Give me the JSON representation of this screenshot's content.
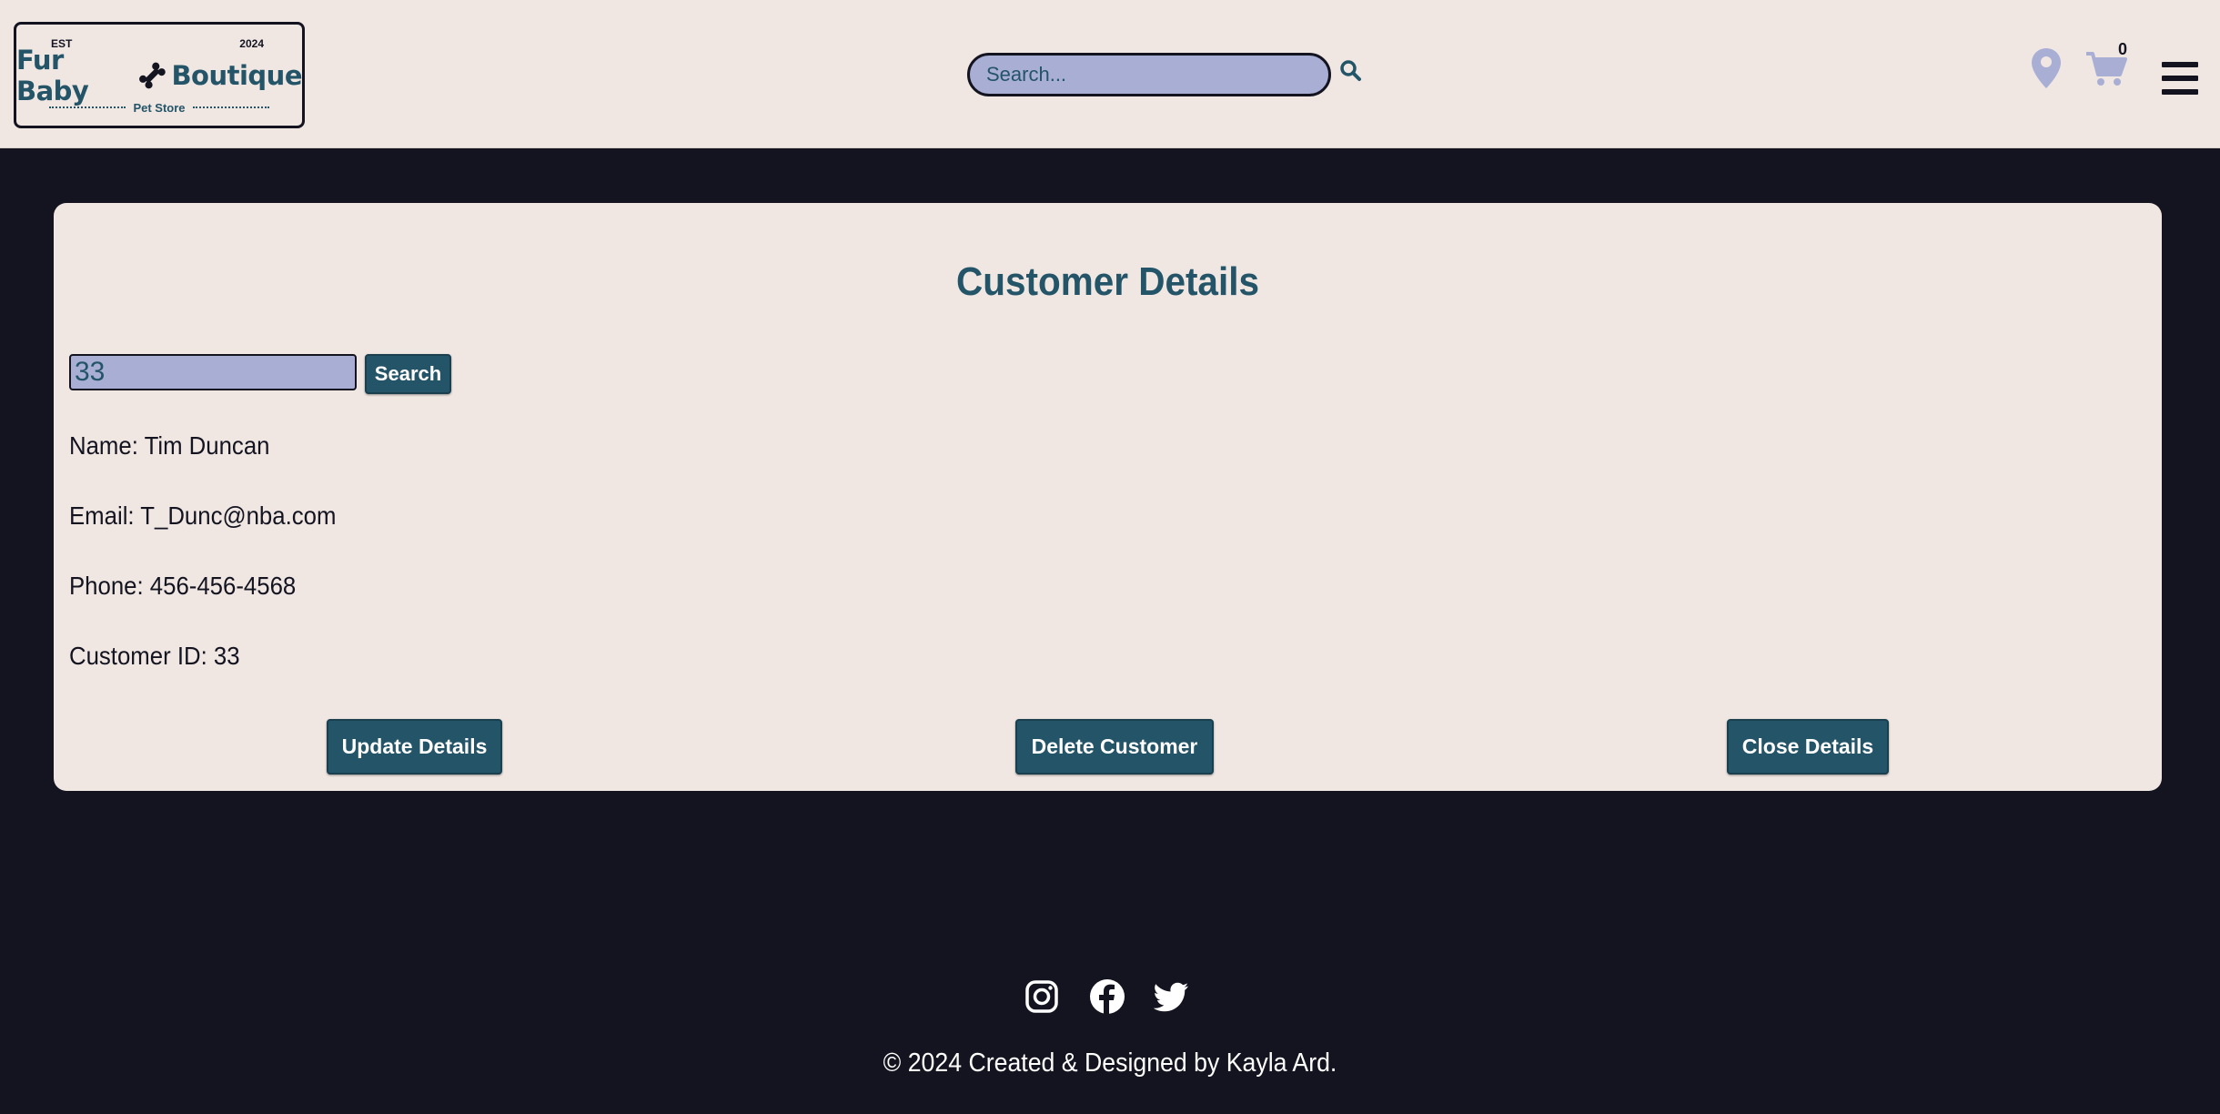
{
  "header": {
    "logo": {
      "est": "EST",
      "year": "2024",
      "brand_left": "Fur Baby",
      "brand_right": "Boutique",
      "sub": "Pet Store"
    },
    "search": {
      "placeholder": "Search..."
    },
    "cart_count": "0"
  },
  "card": {
    "title": "Customer Details",
    "id_input_value": "33",
    "search_label": "Search",
    "name": "Name: Tim Duncan",
    "email": "Email: T_Dunc@nba.com",
    "phone": "Phone: 456-456-4568",
    "customer_id": "Customer ID: 33",
    "update_label": "Update Details",
    "delete_label": "Delete Customer",
    "close_label": "Close Details"
  },
  "footer": {
    "social": [
      "instagram-icon",
      "facebook-icon",
      "twitter-icon"
    ],
    "copyright": "© 2024 Created & Designed by Kayla Ard."
  },
  "colors": {
    "page_bg": "#141421",
    "panel_bg": "#f0e7e3",
    "accent": "#245468",
    "input_bg": "#a9aed5"
  }
}
